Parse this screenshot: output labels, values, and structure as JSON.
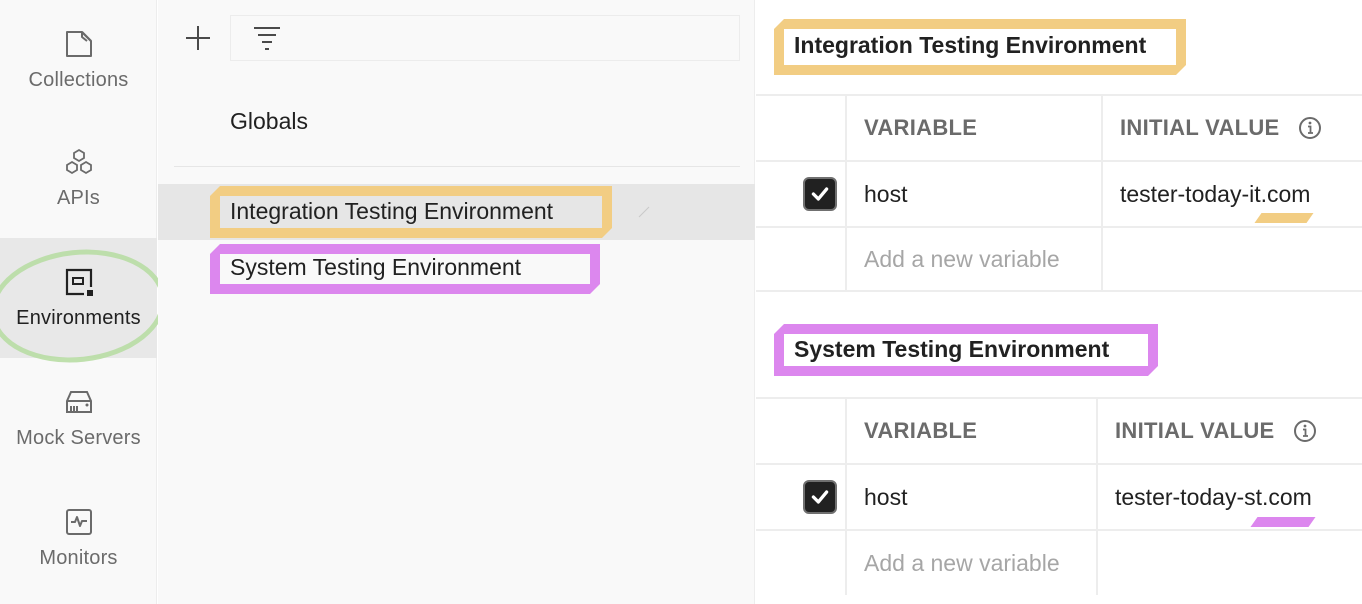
{
  "rail": {
    "items": [
      {
        "label": "Collections",
        "icon": "collections-icon",
        "active": false
      },
      {
        "label": "APIs",
        "icon": "apis-icon",
        "active": false
      },
      {
        "label": "Environments",
        "icon": "environments-icon",
        "active": true
      },
      {
        "label": "Mock Servers",
        "icon": "mock-servers-icon",
        "active": false
      },
      {
        "label": "Monitors",
        "icon": "monitors-icon",
        "active": false
      }
    ]
  },
  "list": {
    "add_icon": "plus-icon",
    "filter_icon": "filter-icon",
    "search_placeholder": "",
    "globals_label": "Globals",
    "environments": [
      {
        "label": "Integration Testing Environment",
        "selected": true,
        "highlight": "#f2cd83"
      },
      {
        "label": "System Testing Environment",
        "selected": false,
        "highlight": "#dc87ee"
      }
    ]
  },
  "detail": {
    "sections": [
      {
        "title": "Integration Testing Environment",
        "highlight": "#f2cd83",
        "headers": {
          "variable": "VARIABLE",
          "initial_value": "INITIAL VALUE"
        },
        "rows": [
          {
            "enabled": true,
            "variable": "host",
            "initial_value": "tester-today-it.com"
          }
        ],
        "add_placeholder": "Add a new variable"
      },
      {
        "title": "System Testing Environment",
        "highlight": "#dc87ee",
        "headers": {
          "variable": "VARIABLE",
          "initial_value": "INITIAL VALUE"
        },
        "rows": [
          {
            "enabled": true,
            "variable": "host",
            "initial_value": "tester-today-st.com"
          }
        ],
        "add_placeholder": "Add a new variable"
      }
    ]
  },
  "annotations": {
    "environments_circle_color": "#b5dca0"
  }
}
